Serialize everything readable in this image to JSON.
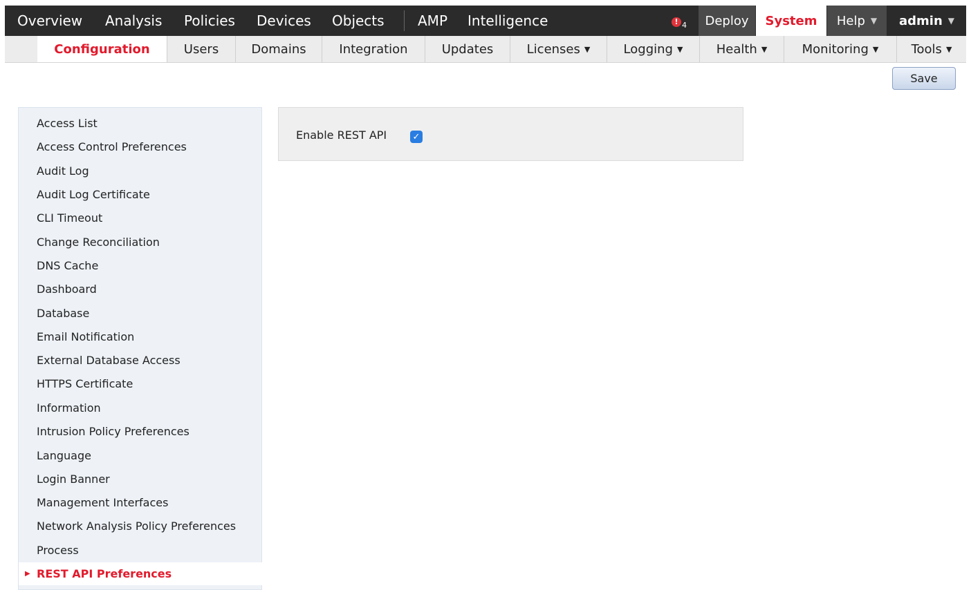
{
  "top_nav": {
    "items": [
      "Overview",
      "Analysis",
      "Policies",
      "Devices",
      "Objects",
      "AMP",
      "Intelligence"
    ],
    "alert_count": "4",
    "deploy": "Deploy",
    "system": "System",
    "help": "Help",
    "admin": "admin"
  },
  "sub_nav": {
    "tabs": [
      "Configuration",
      "Users",
      "Domains",
      "Integration",
      "Updates",
      "Licenses",
      "Logging",
      "Health",
      "Monitoring",
      "Tools"
    ],
    "active": "Configuration"
  },
  "toolbar": {
    "save_label": "Save"
  },
  "sidebar": {
    "items": [
      "Access List",
      "Access Control Preferences",
      "Audit Log",
      "Audit Log Certificate",
      "CLI Timeout",
      "Change Reconciliation",
      "DNS Cache",
      "Dashboard",
      "Database",
      "Email Notification",
      "External Database Access",
      "HTTPS Certificate",
      "Information",
      "Intrusion Policy Preferences",
      "Language",
      "Login Banner",
      "Management Interfaces",
      "Network Analysis Policy Preferences",
      "Process",
      "REST API Preferences"
    ],
    "selected": "REST API Preferences"
  },
  "main": {
    "enable_rest_api_label": "Enable REST API",
    "enable_rest_api_checked": true
  },
  "colors": {
    "topbar": "#2b2b2b",
    "accent_red": "#e21a2c",
    "checkbox_blue": "#2a7de1",
    "sidebar_bg": "#eef2f7"
  }
}
